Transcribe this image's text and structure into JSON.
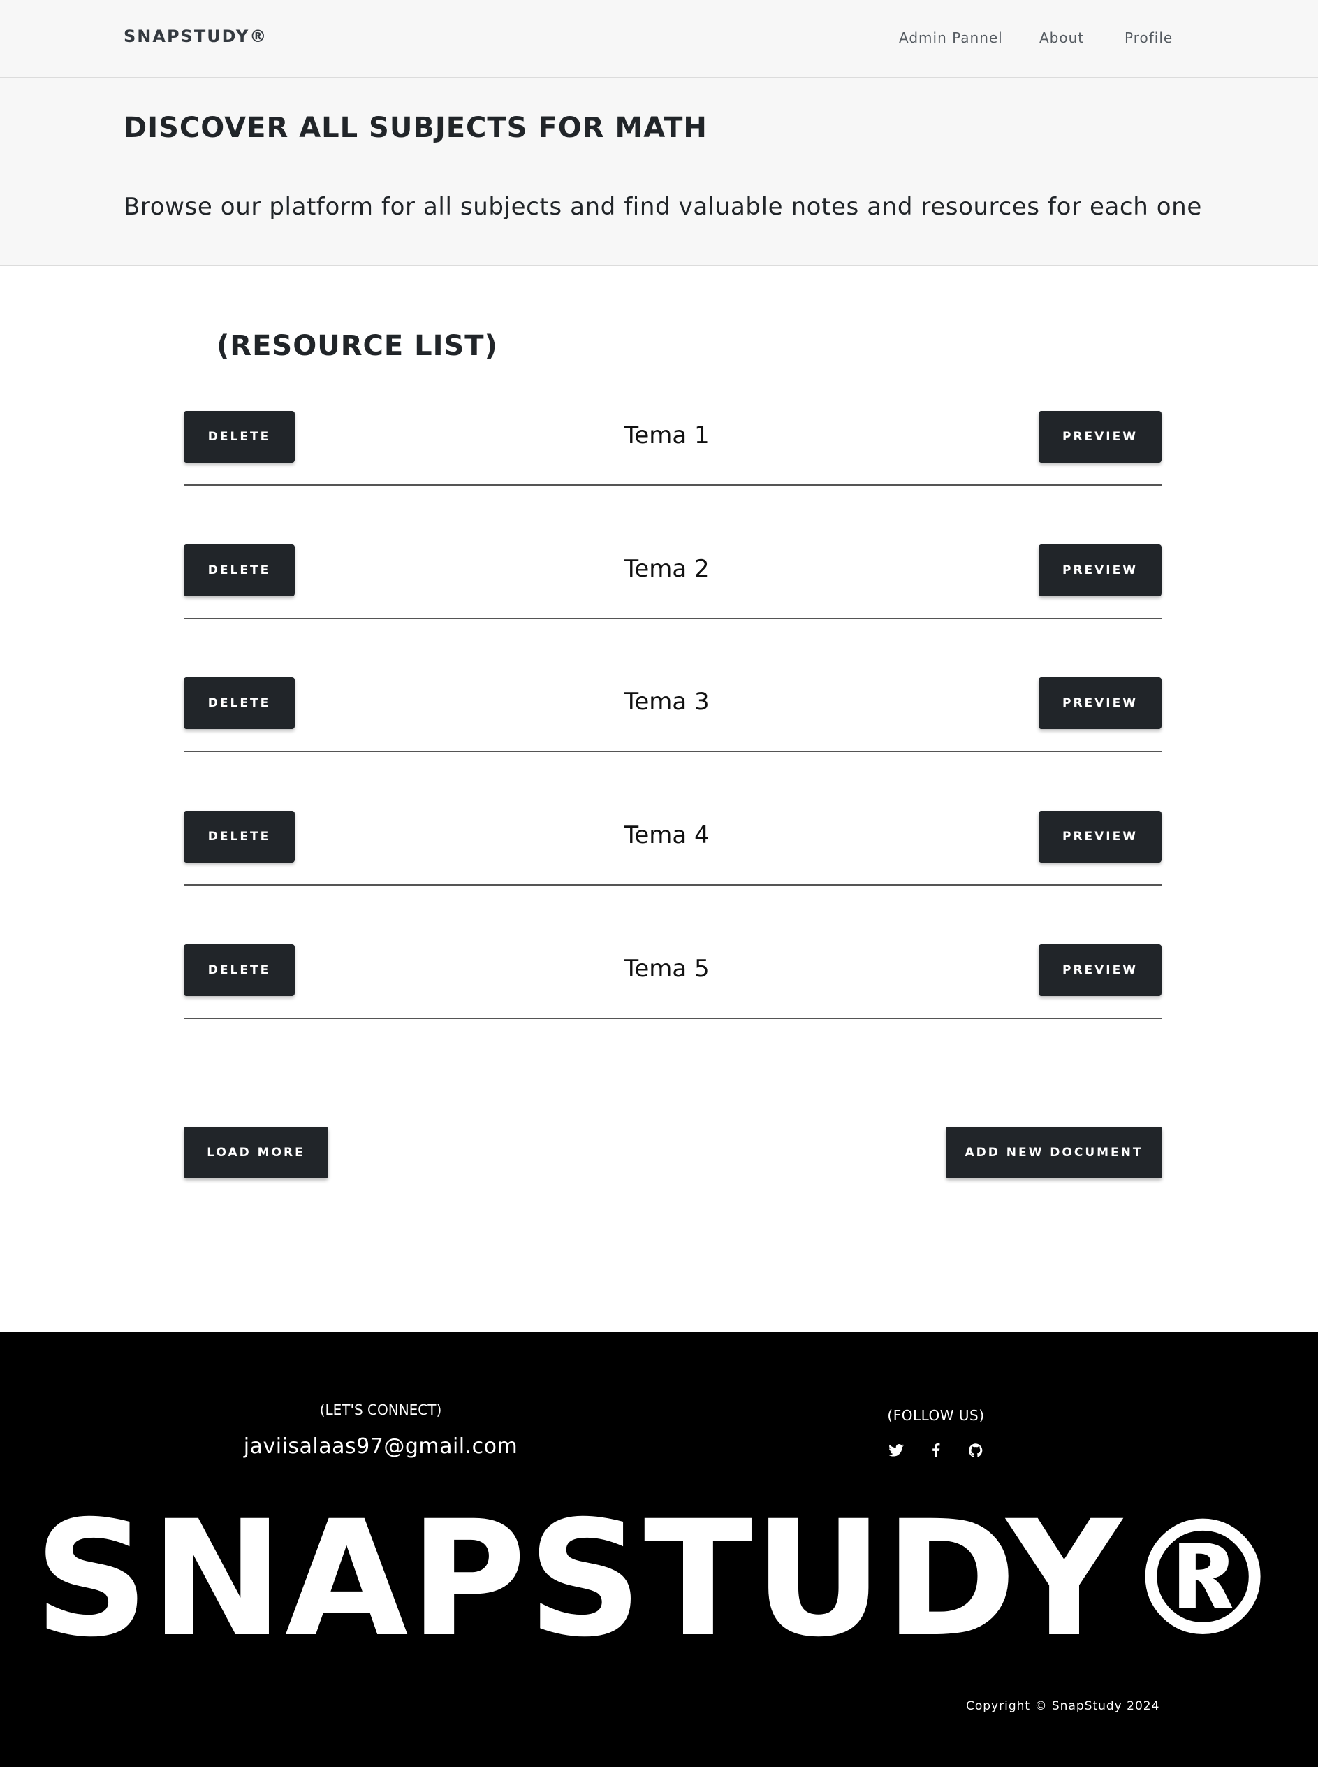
{
  "navbar": {
    "brand": "SNAPSTUDY®",
    "links": [
      "Admin Pannel",
      "About",
      "Profile"
    ]
  },
  "hero": {
    "title": "DISCOVER ALL SUBJECTS FOR MATH",
    "subtitle": "Browse our platform for all subjects and find valuable notes and resources for each one"
  },
  "resources": {
    "title": "(RESOURCE LIST)",
    "delete_label": "DELETE",
    "preview_label": "PREVIEW",
    "items": [
      {
        "name": "Tema 1"
      },
      {
        "name": "Tema 2"
      },
      {
        "name": "Tema 3"
      },
      {
        "name": "Tema 4"
      },
      {
        "name": "Tema 5"
      }
    ],
    "load_more_label": "LOAD MORE",
    "add_new_label": "ADD NEW DOCUMENT"
  },
  "footer": {
    "connect_label": "(LET'S CONNECT)",
    "email": "javiisalaas97@gmail.com",
    "follow_label": "(FOLLOW US)",
    "social_icons": [
      "twitter-icon",
      "facebook-icon",
      "github-icon"
    ],
    "big_brand": "SNAPSTUDY®",
    "copyright": "Copyright © SnapStudy 2024"
  },
  "colors": {
    "navbar_bg": "#f7f7f7",
    "button_bg": "#212529",
    "footer_bg": "#000000"
  }
}
